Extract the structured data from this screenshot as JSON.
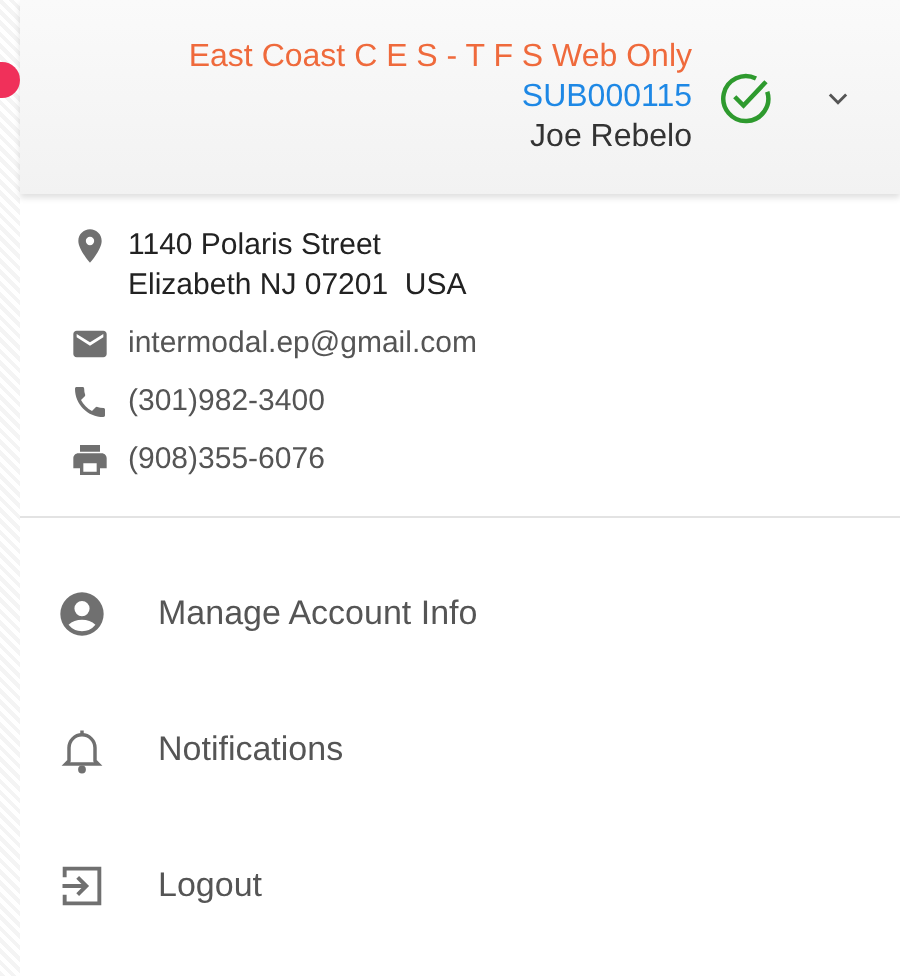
{
  "header": {
    "company": "East Coast C E S - T F S Web Only",
    "account_id": "SUB000115",
    "user_name": "Joe Rebelo",
    "verified": true
  },
  "contact": [
    {
      "kind": "address",
      "lines": [
        "1140 Polaris Street",
        "Elizabeth NJ 07201  USA"
      ]
    },
    {
      "kind": "email",
      "lines": [
        "intermodal.ep@gmail.com"
      ]
    },
    {
      "kind": "phone",
      "lines": [
        "(301)982-3400"
      ]
    },
    {
      "kind": "fax",
      "lines": [
        "(908)355-6076"
      ]
    }
  ],
  "menu": [
    {
      "kind": "account",
      "label": "Manage Account Info"
    },
    {
      "kind": "notifications",
      "label": "Notifications"
    },
    {
      "kind": "logout",
      "label": "Logout"
    }
  ]
}
